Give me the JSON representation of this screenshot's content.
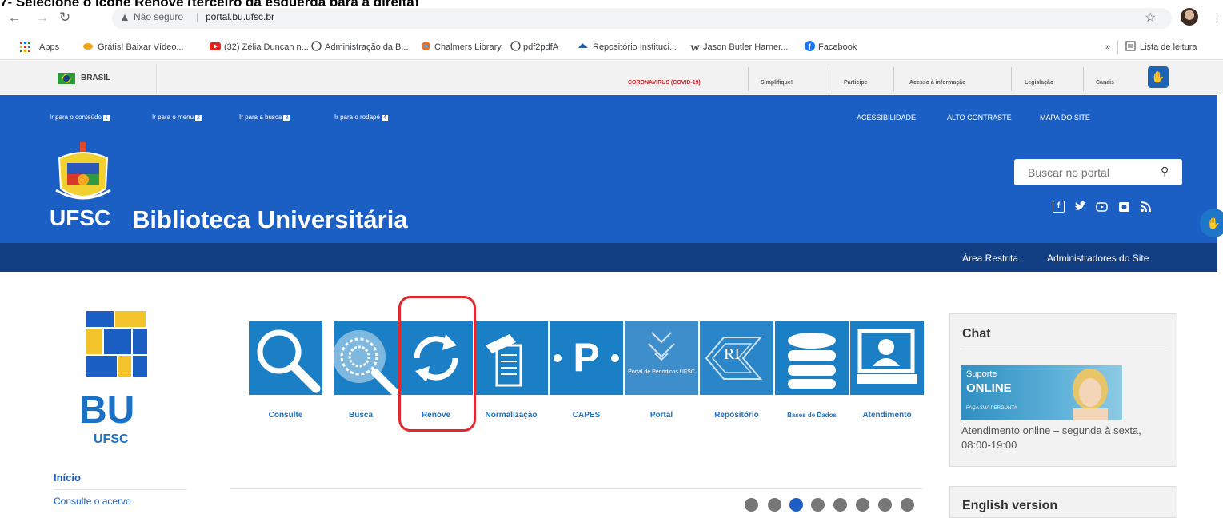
{
  "instruction": "7- Selecione o ícone Renove (terceiro da esquerda para a direita)",
  "browser": {
    "security_label": "Não seguro",
    "url": "portal.bu.ufsc.br",
    "bookmarks": [
      "Apps",
      "Grátis! Baixar Vídeo...",
      "(32) Zélia Duncan n...",
      "Administração da B...",
      "Chalmers Library",
      "pdf2pdfA",
      "Repositório Instituci...",
      "Jason Butler Harner...",
      "Facebook",
      "»",
      "Lista de leitura"
    ]
  },
  "gov_bar": {
    "brand": "BRASIL",
    "links": [
      "CORONAVÍRUS (COVID-19)",
      "Simplifique!",
      "Participe",
      "Acesso à informação",
      "Legislação",
      "Canais"
    ]
  },
  "skip_links": [
    {
      "label": "Ir para o conteúdo",
      "num": "1"
    },
    {
      "label": "Ir para o menu",
      "num": "2"
    },
    {
      "label": "Ir para a busca",
      "num": "3"
    },
    {
      "label": "Ir para o rodapé",
      "num": "4"
    }
  ],
  "accessibility_links": [
    "ACESSIBILIDADE",
    "ALTO CONTRASTE",
    "MAPA DO SITE"
  ],
  "header": {
    "ufsc": "UFSC",
    "title": "Biblioteca Universitária",
    "search_placeholder": "Buscar no portal"
  },
  "social_icons": [
    "facebook-icon",
    "twitter-icon",
    "youtube-icon",
    "instagram-icon",
    "rss-icon"
  ],
  "subnav": [
    "Área Restrita",
    "Administradores do Site"
  ],
  "bu_logo": {
    "big": "BU",
    "small": "UFSC"
  },
  "left_menu": {
    "inicio": "Início",
    "consulte": "Consulte o acervo"
  },
  "tiles": [
    {
      "label": "Consulte",
      "icon": "magnifier-icon"
    },
    {
      "label": "Busca",
      "icon": "globe-icon"
    },
    {
      "label": "Renove",
      "icon": "refresh-icon"
    },
    {
      "label": "Normalização",
      "icon": "document-icon"
    },
    {
      "label": "CAPES",
      "icon": "capes-icon"
    },
    {
      "label": "Portal",
      "icon": "portal-periodicos-icon",
      "inner_text": "Portal de Periódicos UFSC"
    },
    {
      "label": "Repositório",
      "icon": "repository-icon",
      "inner_text": "RI"
    },
    {
      "label": "Bases de Dados",
      "icon": "database-icon"
    },
    {
      "label": "Atendimento",
      "icon": "support-icon"
    }
  ],
  "chat": {
    "title": "Chat",
    "banner_line1": "Suporte",
    "banner_line2": "ONLINE",
    "banner_line3": "FAÇA SUA PERGUNTA",
    "description": "Atendimento online – segunda à sexta, 08:00-19:00"
  },
  "english": {
    "title": "English version"
  },
  "colors": {
    "primary": "#1c5fc4",
    "tile": "#1a7fc4",
    "highlight": "#e0282e"
  }
}
